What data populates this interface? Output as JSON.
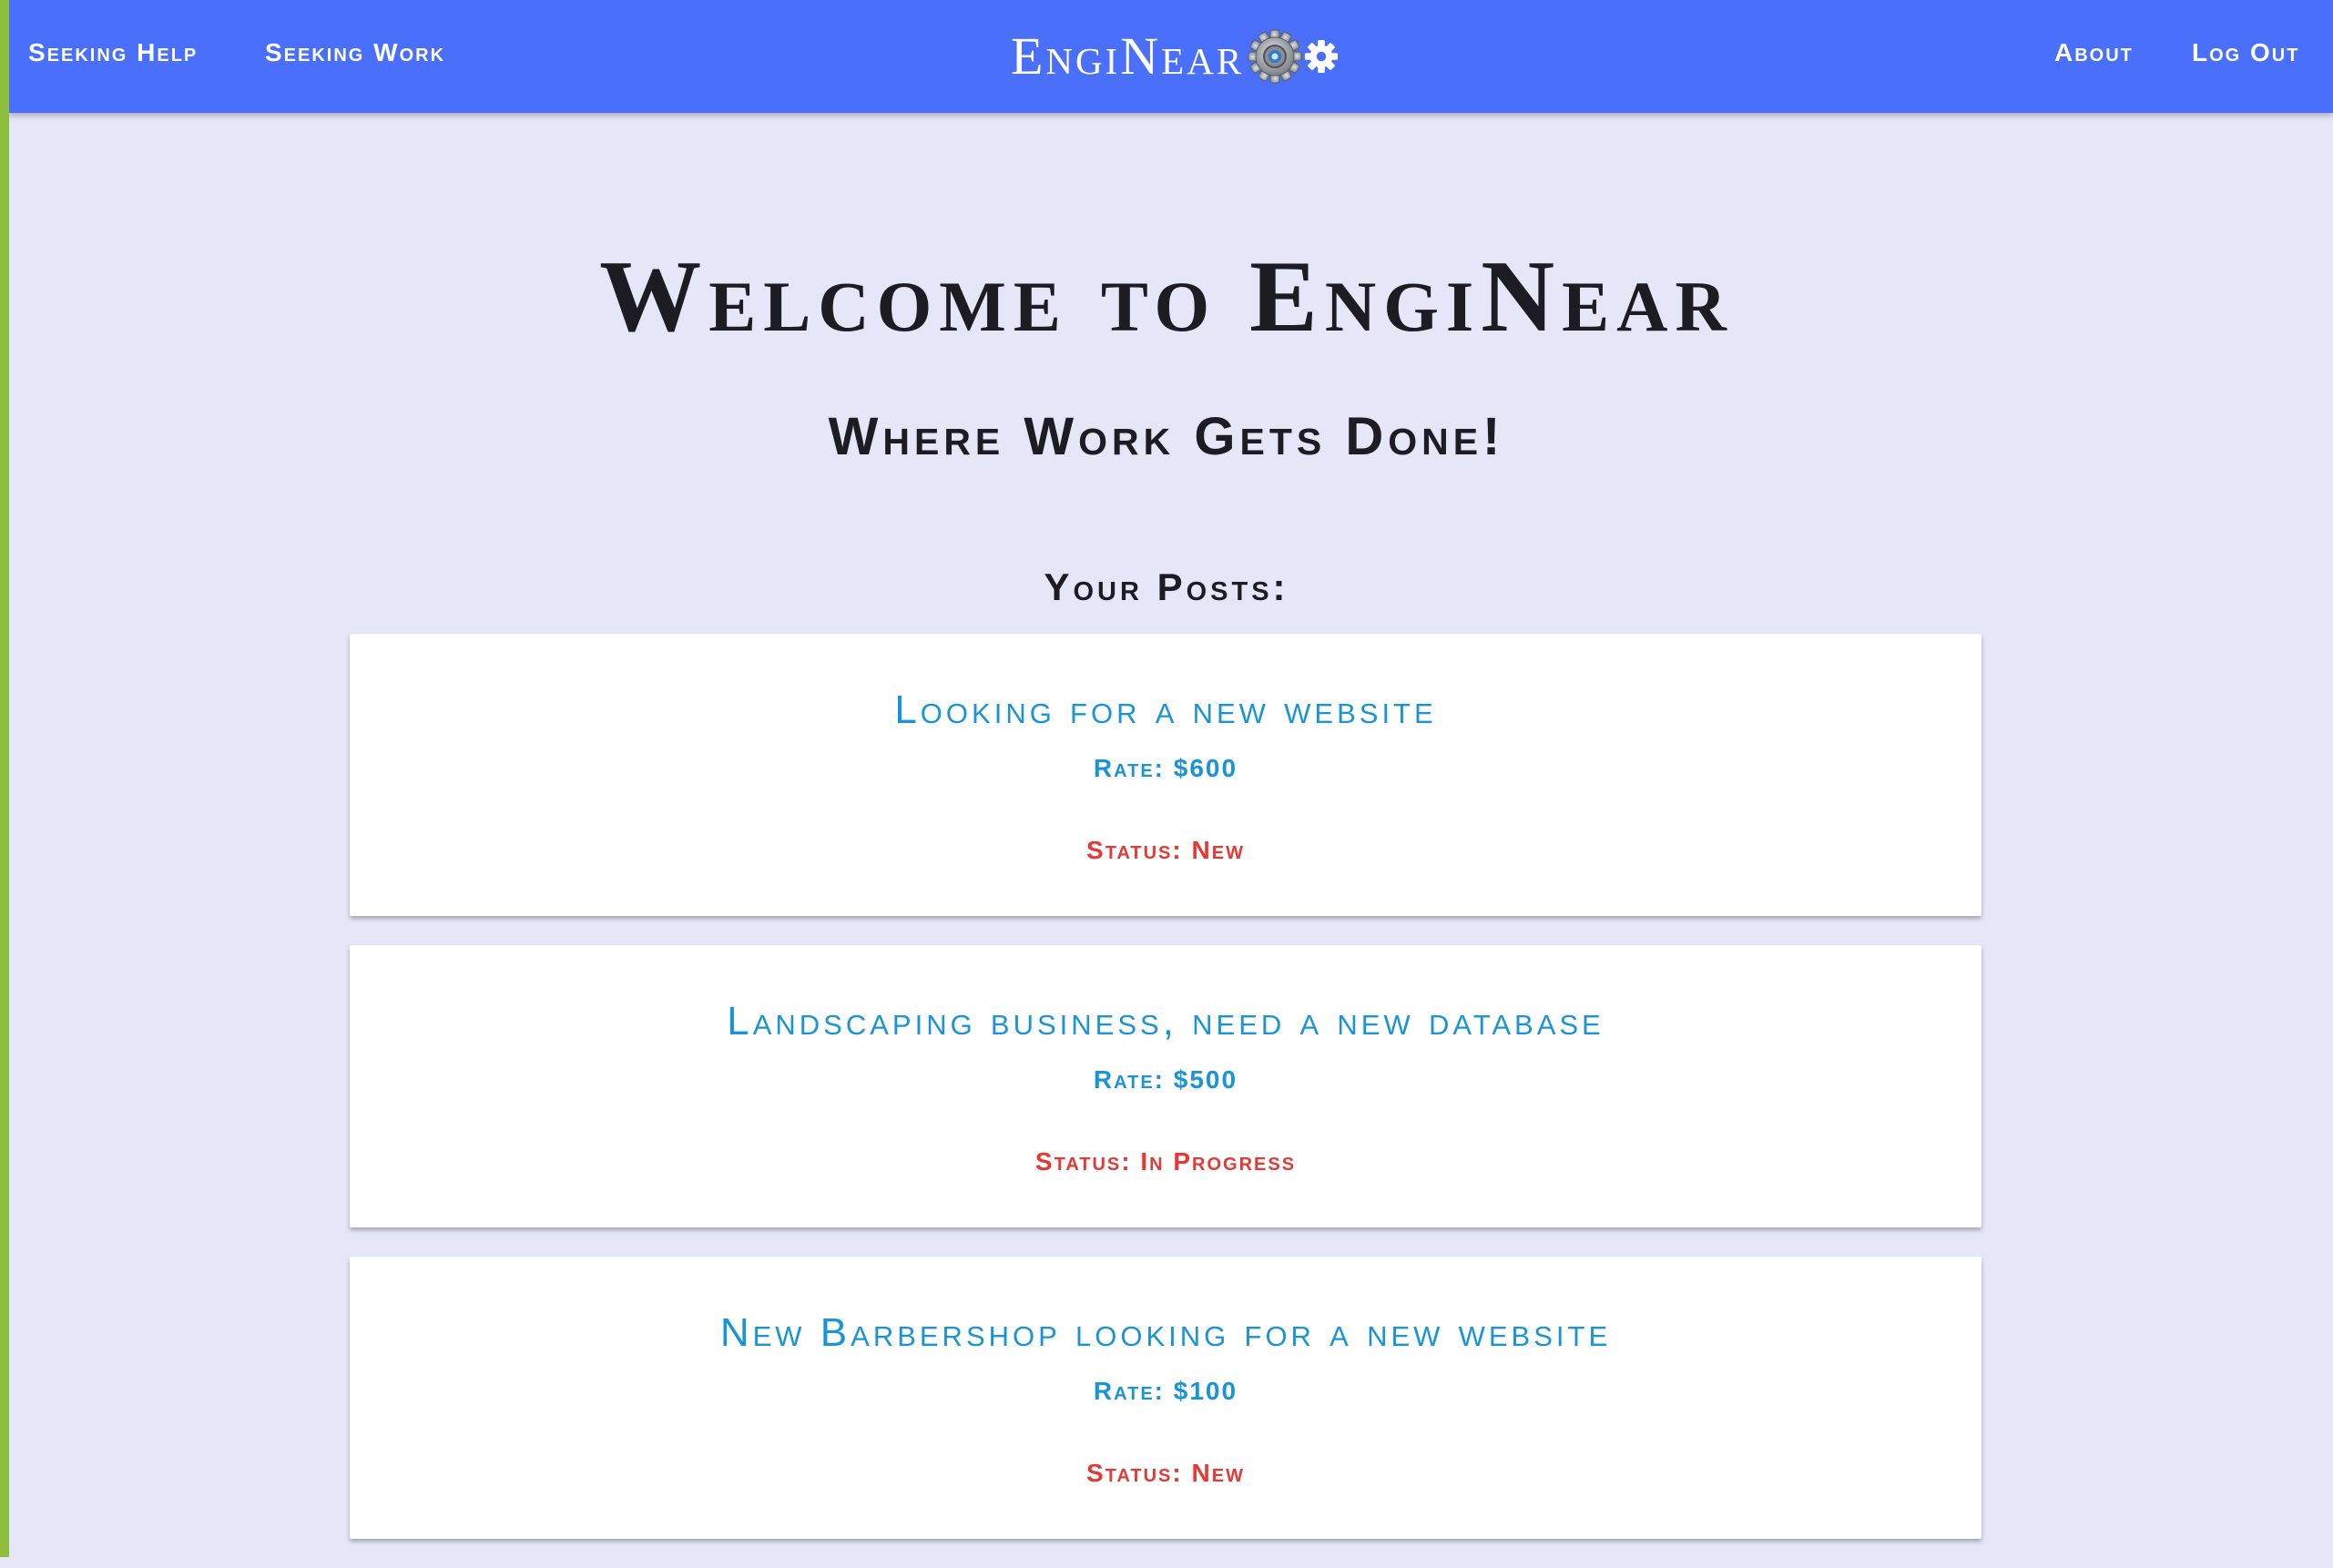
{
  "nav": {
    "left_links": [
      "Seeking Help",
      "Seeking Work"
    ],
    "brand": "EngiNear",
    "brand_icons": [
      "gear-icon",
      "gear-icon"
    ],
    "right_links": [
      "About",
      "Log Out"
    ],
    "background": "#4a6ffa"
  },
  "hero": {
    "title": "Welcome to EngiNear",
    "subtitle": "Where Work Gets Done!"
  },
  "posts_section": {
    "heading": "Your Posts:",
    "posts": [
      {
        "title": "Looking for a new website",
        "rate": "Rate: $600",
        "status": "Status: New"
      },
      {
        "title": "Landscaping business, need a new database",
        "rate": "Rate: $500",
        "status": "Status: In Progress"
      },
      {
        "title": "New Barbershop looking for a new website",
        "rate": "Rate: $100",
        "status": "Status: New"
      }
    ]
  },
  "colors": {
    "page_background": "#e5e6f7",
    "accent_left_border": "#8dbe3c",
    "post_title": "#1a94d6",
    "status_text": "#e53935"
  }
}
